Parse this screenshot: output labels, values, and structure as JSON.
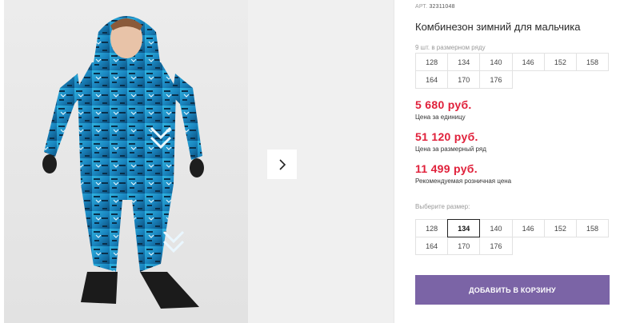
{
  "product": {
    "article_label": "АРТ.",
    "article_number": "32311048",
    "title": "Комбинезон зимний для мальчика",
    "sizes_in_row_label": "9 шт. в размерном ряду",
    "row_sizes": [
      "128",
      "134",
      "140",
      "146",
      "152",
      "158",
      "164",
      "170",
      "176"
    ]
  },
  "prices": {
    "unit_price": "5 680 руб.",
    "unit_caption": "Цена за единицу",
    "row_price": "51 120 руб.",
    "row_caption": "Цена за размерный ряд",
    "retail_price": "11 499 руб.",
    "retail_caption": "Рекомендуемая розничная цена",
    "price_color": "#e0203a"
  },
  "size_picker": {
    "label": "Выберите размер:",
    "sizes": [
      "128",
      "134",
      "140",
      "146",
      "152",
      "158",
      "164",
      "170",
      "176"
    ],
    "selected": "134"
  },
  "cart": {
    "button_label": "ДОБАВИТЬ В КОРЗИНУ",
    "button_color": "#7b64a6"
  },
  "gallery": {
    "next_icon": "chevron-right-icon",
    "photo_subject": "product-photo"
  }
}
